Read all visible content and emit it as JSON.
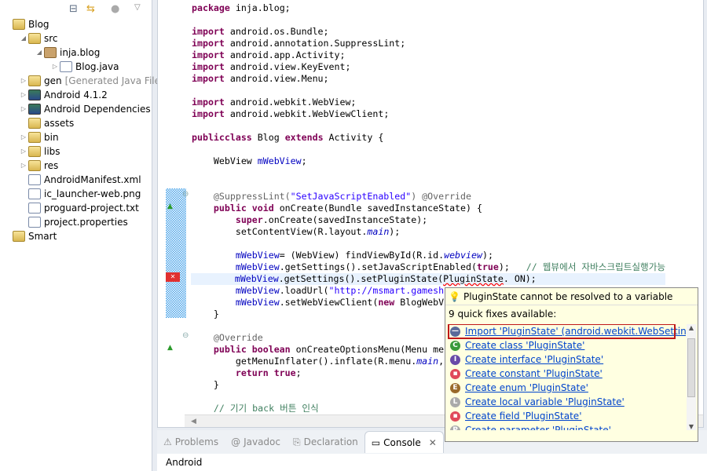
{
  "explorer": {
    "items": [
      {
        "label": "Blog",
        "icon": "project-error-icon",
        "indent": 0,
        "tw": ""
      },
      {
        "label": "src",
        "icon": "source-folder-error-icon",
        "indent": 1,
        "tw": "◢"
      },
      {
        "label": "inja.blog",
        "icon": "package-error-icon",
        "indent": 2,
        "tw": "◢"
      },
      {
        "label": "Blog.java",
        "icon": "java-file-error-icon",
        "indent": 3,
        "tw": "▷"
      },
      {
        "label": "gen",
        "extra": "[Generated Java Files]",
        "icon": "source-folder-icon",
        "indent": 1,
        "tw": "▷"
      },
      {
        "label": "Android 4.1.2",
        "icon": "library-icon",
        "indent": 1,
        "tw": "▷"
      },
      {
        "label": "Android Dependencies",
        "icon": "library-icon",
        "indent": 1,
        "tw": "▷"
      },
      {
        "label": "assets",
        "icon": "folder-icon",
        "indent": 1,
        "tw": ""
      },
      {
        "label": "bin",
        "icon": "folder-icon",
        "indent": 1,
        "tw": "▷"
      },
      {
        "label": "libs",
        "icon": "folder-icon",
        "indent": 1,
        "tw": "▷"
      },
      {
        "label": "res",
        "icon": "folder-icon",
        "indent": 1,
        "tw": "▷"
      },
      {
        "label": "AndroidManifest.xml",
        "icon": "xml-file-icon",
        "indent": 1,
        "tw": ""
      },
      {
        "label": "ic_launcher-web.png",
        "icon": "png-file-icon",
        "indent": 1,
        "tw": ""
      },
      {
        "label": "proguard-project.txt",
        "icon": "text-file-icon",
        "indent": 1,
        "tw": ""
      },
      {
        "label": "project.properties",
        "icon": "text-file-icon",
        "indent": 1,
        "tw": ""
      },
      {
        "label": "Smart",
        "icon": "project-icon",
        "indent": 0,
        "tw": ""
      }
    ]
  },
  "editor": {
    "lines": [
      [
        [
          "k",
          "package"
        ],
        [
          "",
          "inja.blog;"
        ]
      ],
      [],
      [
        [
          "k",
          "import"
        ],
        [
          "",
          "android.os.Bundle;"
        ]
      ],
      [
        [
          "k",
          "import"
        ],
        [
          "",
          "android.annotation.SuppressLint;"
        ]
      ],
      [
        [
          "k",
          "import"
        ],
        [
          "",
          "android.app.Activity;"
        ]
      ],
      [
        [
          "k",
          "import"
        ],
        [
          "",
          "android.view.KeyEvent;"
        ]
      ],
      [
        [
          "k",
          "import"
        ],
        [
          "",
          "android.view.Menu;"
        ]
      ],
      [],
      [
        [
          "k",
          "import"
        ],
        [
          "",
          "android.webkit.WebView;"
        ]
      ],
      [
        [
          "k",
          "import"
        ],
        [
          "",
          "android.webkit.WebViewClient;"
        ]
      ],
      [],
      [
        [
          "k",
          "public"
        ],
        [
          "",
          "",
          ""
        ],
        [
          "k",
          "class"
        ],
        [
          "",
          "Blog"
        ],
        [
          "k",
          "extends"
        ],
        [
          "",
          "Activity {"
        ]
      ],
      [],
      [
        [
          "",
          "    WebView"
        ],
        [
          "f",
          "mWebView"
        ],
        [
          "",
          ";"
        ]
      ],
      [],
      [],
      [
        [
          "a",
          "    @SuppressLint("
        ],
        [
          "s",
          "\"SetJavaScriptEnabled\""
        ],
        [
          "a",
          ") @Override"
        ]
      ],
      [
        [
          "k",
          "    public void"
        ],
        [
          "",
          "onCreate(Bundle savedInstanceState) {"
        ]
      ],
      [
        [
          "k",
          "        super"
        ],
        [
          "",
          ".onCreate(savedInstanceState);"
        ]
      ],
      [
        [
          "",
          "        setContentView(R.layout."
        ],
        [
          "i",
          "main"
        ],
        [
          "",
          ");"
        ]
      ],
      [],
      [
        [
          "f",
          "        mWebView"
        ],
        [
          "",
          "= (WebView) findViewById(R.id."
        ],
        [
          "i",
          "webview"
        ],
        [
          "",
          ");"
        ]
      ],
      [
        [
          "f",
          "        mWebView"
        ],
        [
          "",
          ".getSettings().setJavaScriptEnabled("
        ],
        [
          "k",
          "true"
        ],
        [
          "",
          ");  "
        ],
        [
          "c",
          "// 웹뷰에서 자바스크립트실행가능"
        ]
      ],
      [
        [
          "f",
          "        mWebView"
        ],
        [
          "",
          ".getSettings().setPluginState("
        ],
        [
          "err",
          "PluginState"
        ],
        [
          "",
          ". ON);"
        ]
      ],
      [
        [
          "f",
          "        mWebView"
        ],
        [
          "",
          ".loadUrl("
        ],
        [
          "s",
          "\"http://msmart.gamesh"
        ]
      ],
      [
        [
          "f",
          "        mWebView"
        ],
        [
          "",
          ".setWebViewClient("
        ],
        [
          "k",
          "new"
        ],
        [
          "",
          "BlogWebV"
        ]
      ],
      [
        [
          "",
          "    }"
        ]
      ],
      [],
      [
        [
          "a",
          "    @Override"
        ]
      ],
      [
        [
          "k",
          "    public boolean"
        ],
        [
          "",
          "onCreateOptionsMenu(Menu me"
        ]
      ],
      [
        [
          "",
          "        getMenuInflater().inflate(R.menu."
        ],
        [
          "i",
          "main"
        ],
        [
          "",
          ","
        ]
      ],
      [
        [
          "k",
          "        return true"
        ],
        [
          "",
          ";"
        ]
      ],
      [
        [
          "",
          "    }"
        ]
      ],
      [],
      [
        [
          "c",
          "    // 기기 back 버튼 인식"
        ]
      ]
    ]
  },
  "bottom": {
    "tabs": [
      {
        "label": "Problems",
        "icon": "problems-icon"
      },
      {
        "label": "Javadoc",
        "icon": "at-icon"
      },
      {
        "label": "Declaration",
        "icon": "declaration-icon"
      },
      {
        "label": "Console",
        "icon": "console-icon",
        "active": true
      }
    ],
    "console_title": "Android"
  },
  "popup": {
    "title": "PluginState cannot be resolved to a variable",
    "subtitle": "9 quick fixes available:",
    "fixes": [
      {
        "label": "Import 'PluginState' (android.webkit.WebSettings)",
        "icon": "import-icon",
        "color": "#5a6a9a",
        "glyph": "—",
        "selected": true
      },
      {
        "label": "Create class 'PluginState'",
        "icon": "class-icon",
        "color": "#3a9a3a",
        "glyph": "C"
      },
      {
        "label": "Create interface 'PluginState'",
        "icon": "interface-icon",
        "color": "#6a4aa8",
        "glyph": "I"
      },
      {
        "label": "Create constant 'PluginState'",
        "icon": "constant-icon",
        "color": "#e04a5a",
        "glyph": "▪"
      },
      {
        "label": "Create enum 'PluginState'",
        "icon": "enum-icon",
        "color": "#9a6a2a",
        "glyph": "E"
      },
      {
        "label": "Create local variable 'PluginState'",
        "icon": "local-variable-icon",
        "color": "#aaaaaa",
        "glyph": "L"
      },
      {
        "label": "Create field 'PluginState'",
        "icon": "field-icon",
        "color": "#e04a5a",
        "glyph": "▪"
      },
      {
        "label": "Create parameter 'PluginState'",
        "icon": "parameter-icon",
        "color": "#aaaaaa",
        "glyph": "P"
      }
    ]
  }
}
